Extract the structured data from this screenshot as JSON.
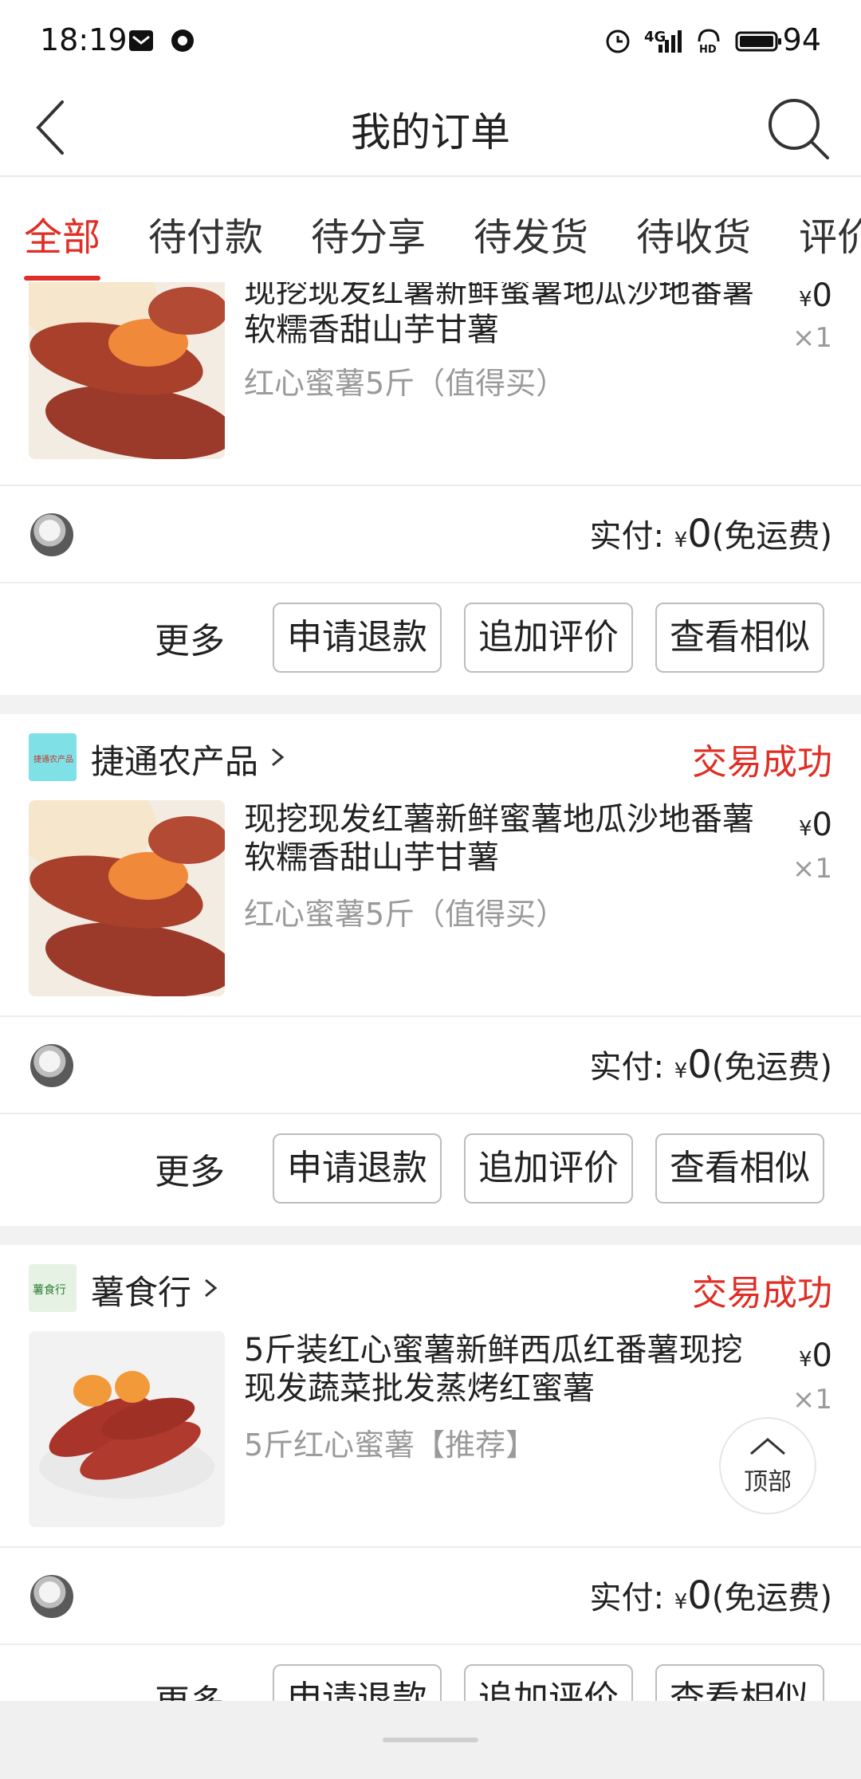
{
  "status_bar": {
    "time": "18:19",
    "battery": "94",
    "network": "4G"
  },
  "nav": {
    "title": "我的订单"
  },
  "tabs": [
    {
      "label": "全部",
      "active": true
    },
    {
      "label": "待付款"
    },
    {
      "label": "待分享"
    },
    {
      "label": "待发货"
    },
    {
      "label": "待收货"
    },
    {
      "label": "评价"
    }
  ],
  "currency": "¥",
  "paid_label": "实付:",
  "shipping_note": "(免运费)",
  "more_label": "更多",
  "buttons": {
    "refund": "申请退款",
    "review": "追加评价",
    "similar": "查看相似"
  },
  "orders": [
    {
      "item_title": "现挖现发红薯新鲜蜜薯地瓜沙地番薯软糯香甜山芋甘薯",
      "item_spec": "红心蜜薯5斤（值得买）",
      "price": "0",
      "qty": "×1",
      "paid": "0"
    },
    {
      "store": "捷通农产品",
      "store_logo_text": "捷通农产品",
      "status": "交易成功",
      "item_title": "现挖现发红薯新鲜蜜薯地瓜沙地番薯软糯香甜山芋甘薯",
      "item_spec": "红心蜜薯5斤（值得买）",
      "price": "0",
      "qty": "×1",
      "paid": "0"
    },
    {
      "store": "薯食行",
      "store_logo_text": "薯食行",
      "status": "交易成功",
      "item_title": "5斤装红心蜜薯新鲜西瓜红番薯现挖现发蔬菜批发蒸烤红蜜薯",
      "item_spec": "5斤红心蜜薯【推荐】",
      "price": "0",
      "qty": "×1",
      "paid": "0"
    }
  ],
  "top_button": {
    "label": "顶部"
  },
  "colors": {
    "accent": "#e02e24",
    "secondary_text": "#9a9a9a",
    "background_gap": "#f2f2f2"
  }
}
